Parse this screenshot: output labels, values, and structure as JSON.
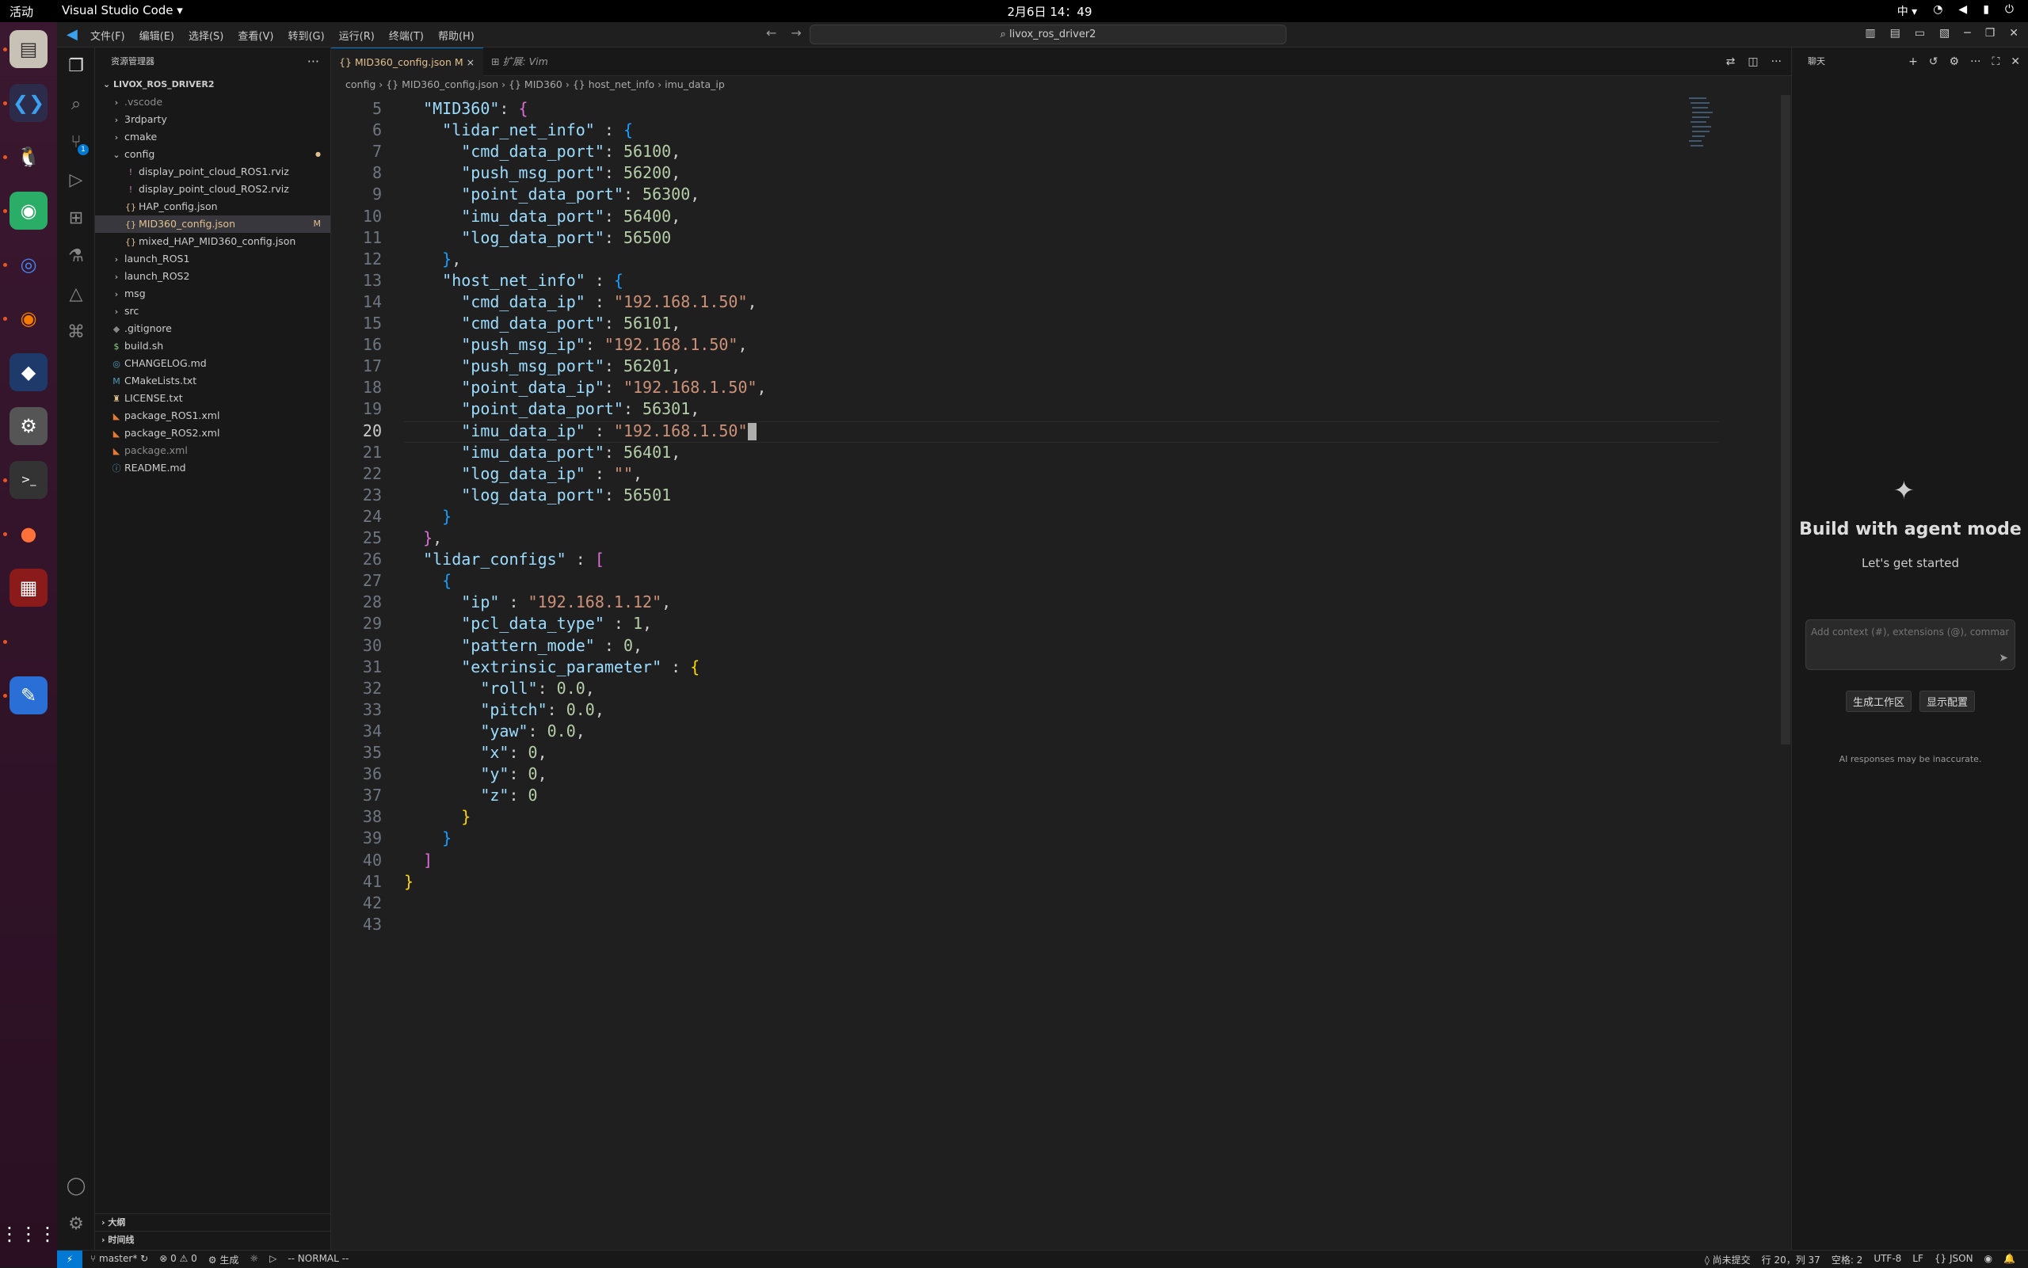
{
  "topbar": {
    "activities": "活动",
    "app": "Visual Studio Code ▾",
    "clock": "2月6日 14：49",
    "ime": "中 ▾"
  },
  "dock": {
    "items": [
      "files",
      "vscode",
      "qq",
      "wechat",
      "chrome",
      "blender",
      "cat-app",
      "settings",
      "terminal",
      "firefox",
      "app-screen",
      "text-editor"
    ],
    "grid": "⋮⋮⋮"
  },
  "titlebar": {
    "menus": [
      "文件(F)",
      "编辑(E)",
      "选择(S)",
      "查看(V)",
      "转到(G)",
      "运行(R)",
      "终端(T)",
      "帮助(H)"
    ],
    "search": "livox_ros_driver2"
  },
  "sidebar": {
    "title": "资源管理器",
    "more": "···",
    "root": "LIVOX_ROS_DRIVER2",
    "items": [
      {
        "label": ".vscode",
        "type": "folder"
      },
      {
        "label": "3rdparty",
        "type": "folder"
      },
      {
        "label": "cmake",
        "type": "folder"
      },
      {
        "label": "config",
        "type": "folder-open"
      },
      {
        "label": "display_point_cloud_ROS1.rviz",
        "type": "rviz"
      },
      {
        "label": "display_point_cloud_ROS2.rviz",
        "type": "rviz"
      },
      {
        "label": "HAP_config.json",
        "type": "json"
      },
      {
        "label": "MID360_config.json",
        "type": "json",
        "status": "M"
      },
      {
        "label": "mixed_HAP_MID360_config.json",
        "type": "json"
      },
      {
        "label": "launch_ROS1",
        "type": "folder"
      },
      {
        "label": "launch_ROS2",
        "type": "folder"
      },
      {
        "label": "msg",
        "type": "folder"
      },
      {
        "label": "src",
        "type": "folder"
      },
      {
        "label": ".gitignore",
        "type": "git"
      },
      {
        "label": "build.sh",
        "type": "sh"
      },
      {
        "label": "CHANGELOG.md",
        "type": "md"
      },
      {
        "label": "CMakeLists.txt",
        "type": "cmake"
      },
      {
        "label": "LICENSE.txt",
        "type": "lic"
      },
      {
        "label": "package_ROS1.xml",
        "type": "xml"
      },
      {
        "label": "package_ROS2.xml",
        "type": "xml"
      },
      {
        "label": "package.xml",
        "type": "xml"
      },
      {
        "label": "README.md",
        "type": "info"
      }
    ],
    "outline": "大纲",
    "timeline": "时间线"
  },
  "tabs": [
    {
      "label": "{} MID360_config.json M",
      "close": "×"
    },
    {
      "label": "⊞ 扩展: Vim"
    }
  ],
  "breadcrumb": [
    "config",
    "{} MID360_config.json",
    "{} MID360",
    "{} host_net_info",
    "imu_data_ip"
  ],
  "code": {
    "lines": [
      {
        "n": "5",
        "t": [
          [
            "  ",
            ""
          ],
          [
            "\"MID360\"",
            "k"
          ],
          [
            ": ",
            "p"
          ],
          [
            "{",
            "b2"
          ]
        ]
      },
      {
        "n": "6",
        "t": [
          [
            "    ",
            ""
          ],
          [
            "\"lidar_net_info\"",
            "k"
          ],
          [
            " : ",
            "p"
          ],
          [
            "{",
            "b3"
          ]
        ]
      },
      {
        "n": "7",
        "t": [
          [
            "      ",
            ""
          ],
          [
            "\"cmd_data_port\"",
            "k"
          ],
          [
            ": ",
            "p"
          ],
          [
            "56100",
            "n"
          ],
          [
            ",",
            "p"
          ]
        ]
      },
      {
        "n": "8",
        "t": [
          [
            "      ",
            ""
          ],
          [
            "\"push_msg_port\"",
            "k"
          ],
          [
            ": ",
            "p"
          ],
          [
            "56200",
            "n"
          ],
          [
            ",",
            "p"
          ]
        ]
      },
      {
        "n": "9",
        "t": [
          [
            "      ",
            ""
          ],
          [
            "\"point_data_port\"",
            "k"
          ],
          [
            ": ",
            "p"
          ],
          [
            "56300",
            "n"
          ],
          [
            ",",
            "p"
          ]
        ]
      },
      {
        "n": "10",
        "t": [
          [
            "      ",
            ""
          ],
          [
            "\"imu_data_port\"",
            "k"
          ],
          [
            ": ",
            "p"
          ],
          [
            "56400",
            "n"
          ],
          [
            ",",
            "p"
          ]
        ]
      },
      {
        "n": "11",
        "t": [
          [
            "      ",
            ""
          ],
          [
            "\"log_data_port\"",
            "k"
          ],
          [
            ": ",
            "p"
          ],
          [
            "56500",
            "n"
          ]
        ]
      },
      {
        "n": "12",
        "t": [
          [
            "    ",
            ""
          ],
          [
            "}",
            "b3"
          ],
          [
            ",",
            "p"
          ]
        ]
      },
      {
        "n": "13",
        "t": [
          [
            "    ",
            ""
          ],
          [
            "\"host_net_info\"",
            "k"
          ],
          [
            " : ",
            "p"
          ],
          [
            "{",
            "b3"
          ]
        ]
      },
      {
        "n": "14",
        "t": [
          [
            "      ",
            ""
          ],
          [
            "\"cmd_data_ip\"",
            "k"
          ],
          [
            " : ",
            "p"
          ],
          [
            "\"192.168.1.50\"",
            "s"
          ],
          [
            ",",
            "p"
          ]
        ]
      },
      {
        "n": "15",
        "t": [
          [
            "      ",
            ""
          ],
          [
            "\"cmd_data_port\"",
            "k"
          ],
          [
            ": ",
            "p"
          ],
          [
            "56101",
            "n"
          ],
          [
            ",",
            "p"
          ]
        ]
      },
      {
        "n": "16",
        "t": [
          [
            "      ",
            ""
          ],
          [
            "\"push_msg_ip\"",
            "k"
          ],
          [
            ": ",
            "p"
          ],
          [
            "\"192.168.1.50\"",
            "s"
          ],
          [
            ",",
            "p"
          ]
        ]
      },
      {
        "n": "17",
        "t": [
          [
            "      ",
            ""
          ],
          [
            "\"push_msg_port\"",
            "k"
          ],
          [
            ": ",
            "p"
          ],
          [
            "56201",
            "n"
          ],
          [
            ",",
            "p"
          ]
        ]
      },
      {
        "n": "18",
        "t": [
          [
            "      ",
            ""
          ],
          [
            "\"point_data_ip\"",
            "k"
          ],
          [
            ": ",
            "p"
          ],
          [
            "\"192.168.1.50\"",
            "s"
          ],
          [
            ",",
            "p"
          ]
        ]
      },
      {
        "n": "19",
        "t": [
          [
            "      ",
            ""
          ],
          [
            "\"point_data_port\"",
            "k"
          ],
          [
            ": ",
            "p"
          ],
          [
            "56301",
            "n"
          ],
          [
            ",",
            "p"
          ]
        ]
      },
      {
        "n": "20",
        "t": [
          [
            "      ",
            ""
          ],
          [
            "\"imu_data_ip\"",
            "k"
          ],
          [
            " : ",
            "p"
          ],
          [
            "\"192.168.1.50\"",
            "s"
          ]
        ],
        "cur": true
      },
      {
        "n": "21",
        "t": [
          [
            "      ",
            ""
          ],
          [
            "\"imu_data_port\"",
            "k"
          ],
          [
            ": ",
            "p"
          ],
          [
            "56401",
            "n"
          ],
          [
            ",",
            "p"
          ]
        ]
      },
      {
        "n": "22",
        "t": [
          [
            "      ",
            ""
          ],
          [
            "\"log_data_ip\"",
            "k"
          ],
          [
            " : ",
            "p"
          ],
          [
            "\"\"",
            "s"
          ],
          [
            ",",
            "p"
          ]
        ]
      },
      {
        "n": "23",
        "t": [
          [
            "      ",
            ""
          ],
          [
            "\"log_data_port\"",
            "k"
          ],
          [
            ": ",
            "p"
          ],
          [
            "56501",
            "n"
          ]
        ]
      },
      {
        "n": "24",
        "t": [
          [
            "    ",
            ""
          ],
          [
            "}",
            "b3"
          ]
        ]
      },
      {
        "n": "25",
        "t": [
          [
            "  ",
            ""
          ],
          [
            "}",
            "b2"
          ],
          [
            ",",
            "p"
          ]
        ]
      },
      {
        "n": "26",
        "t": [
          [
            "  ",
            ""
          ],
          [
            "\"lidar_configs\"",
            "k"
          ],
          [
            " : ",
            "p"
          ],
          [
            "[",
            "b2"
          ]
        ]
      },
      {
        "n": "27",
        "t": [
          [
            "    ",
            ""
          ],
          [
            "{",
            "b3"
          ]
        ]
      },
      {
        "n": "28",
        "t": [
          [
            "      ",
            ""
          ],
          [
            "\"ip\"",
            "k"
          ],
          [
            " : ",
            "p"
          ],
          [
            "\"192.168.1.12\"",
            "s"
          ],
          [
            ",",
            "p"
          ]
        ]
      },
      {
        "n": "29",
        "t": [
          [
            "      ",
            ""
          ],
          [
            "\"pcl_data_type\"",
            "k"
          ],
          [
            " : ",
            "p"
          ],
          [
            "1",
            "n"
          ],
          [
            ",",
            "p"
          ]
        ]
      },
      {
        "n": "30",
        "t": [
          [
            "      ",
            ""
          ],
          [
            "\"pattern_mode\"",
            "k"
          ],
          [
            " : ",
            "p"
          ],
          [
            "0",
            "n"
          ],
          [
            ",",
            "p"
          ]
        ]
      },
      {
        "n": "31",
        "t": [
          [
            "      ",
            ""
          ],
          [
            "\"extrinsic_parameter\"",
            "k"
          ],
          [
            " : ",
            "p"
          ],
          [
            "{",
            "b1"
          ]
        ]
      },
      {
        "n": "32",
        "t": [
          [
            "        ",
            ""
          ],
          [
            "\"roll\"",
            "k"
          ],
          [
            ": ",
            "p"
          ],
          [
            "0.0",
            "n"
          ],
          [
            ",",
            "p"
          ]
        ]
      },
      {
        "n": "33",
        "t": [
          [
            "        ",
            ""
          ],
          [
            "\"pitch\"",
            "k"
          ],
          [
            ": ",
            "p"
          ],
          [
            "0.0",
            "n"
          ],
          [
            ",",
            "p"
          ]
        ]
      },
      {
        "n": "34",
        "t": [
          [
            "        ",
            ""
          ],
          [
            "\"yaw\"",
            "k"
          ],
          [
            ": ",
            "p"
          ],
          [
            "0.0",
            "n"
          ],
          [
            ",",
            "p"
          ]
        ]
      },
      {
        "n": "35",
        "t": [
          [
            "        ",
            ""
          ],
          [
            "\"x\"",
            "k"
          ],
          [
            ": ",
            "p"
          ],
          [
            "0",
            "n"
          ],
          [
            ",",
            "p"
          ]
        ]
      },
      {
        "n": "36",
        "t": [
          [
            "        ",
            ""
          ],
          [
            "\"y\"",
            "k"
          ],
          [
            ": ",
            "p"
          ],
          [
            "0",
            "n"
          ],
          [
            ",",
            "p"
          ]
        ]
      },
      {
        "n": "37",
        "t": [
          [
            "        ",
            ""
          ],
          [
            "\"z\"",
            "k"
          ],
          [
            ": ",
            "p"
          ],
          [
            "0",
            "n"
          ]
        ]
      },
      {
        "n": "38",
        "t": [
          [
            "      ",
            ""
          ],
          [
            "}",
            "b1"
          ]
        ]
      },
      {
        "n": "39",
        "t": [
          [
            "    ",
            ""
          ],
          [
            "}",
            "b3"
          ]
        ]
      },
      {
        "n": "40",
        "t": [
          [
            "  ",
            ""
          ],
          [
            "]",
            "b2"
          ]
        ]
      },
      {
        "n": "41",
        "t": [
          [
            "",
            ""
          ],
          [
            "}",
            "b1"
          ]
        ]
      },
      {
        "n": "42",
        "t": []
      },
      {
        "n": "43",
        "t": []
      }
    ]
  },
  "chat": {
    "title": "聊天",
    "heading": "Build with agent mode",
    "sub": "Let's get started",
    "placeholder": "Add context (#), extensions (@), commands",
    "btn1": "生成工作区",
    "btn2": "显示配置",
    "disclaimer": "AI responses may be inaccurate."
  },
  "status": {
    "branch": "master*",
    "errors": "⊗ 0 ⚠ 0",
    "build": "⚙ 生成",
    "mode": "-- NORMAL --",
    "commit": "◊ 尚未提交",
    "pos": "行 20，列 37",
    "spaces": "空格: 2",
    "enc": "UTF-8",
    "eol": "LF",
    "lang": "{} JSON"
  }
}
